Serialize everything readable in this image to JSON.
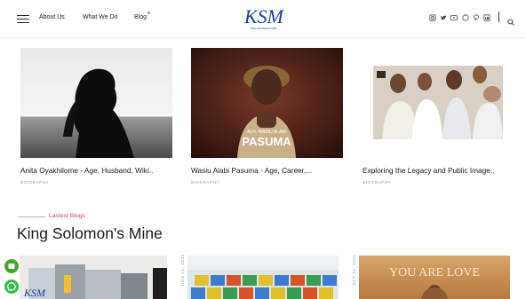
{
  "nav": {
    "about": "About Us",
    "what": "What We Do",
    "blog": "Blog"
  },
  "logo": {
    "text": "KSM",
    "subtext": "KING SOLOMON'S MINE"
  },
  "social_icons": [
    "instagram-icon",
    "twitter-icon",
    "youtube-icon",
    "whatsapp-icon",
    "pinterest-icon",
    "linkedin-icon"
  ],
  "cards": [
    {
      "title": "Anita Oyakhilome - Age, Husband, Wiki..",
      "category": "BIOGRAPHY"
    },
    {
      "title": "Wasiu Alabi Pasuma - Age, Career,...",
      "category": "BIOGRAPHY",
      "poster_top": "ALH. WASIU ALABI",
      "poster_name": "PASUMA"
    },
    {
      "title": "Exploring the Legacy and Public Image..",
      "category": "BIOGRAPHY"
    }
  ],
  "section": {
    "subtitle": "Lastest Blogs",
    "title": "King Solomon's Mine"
  },
  "bottom": {
    "date1": "NOV 12, 2022",
    "date2": "OCT 21, 2025",
    "love_text": "YOU ARE LOVE"
  },
  "colors": {
    "accent": "#c1455f",
    "logo_blue": "#1c3d9e",
    "whatsapp": "#2fbd4c"
  }
}
